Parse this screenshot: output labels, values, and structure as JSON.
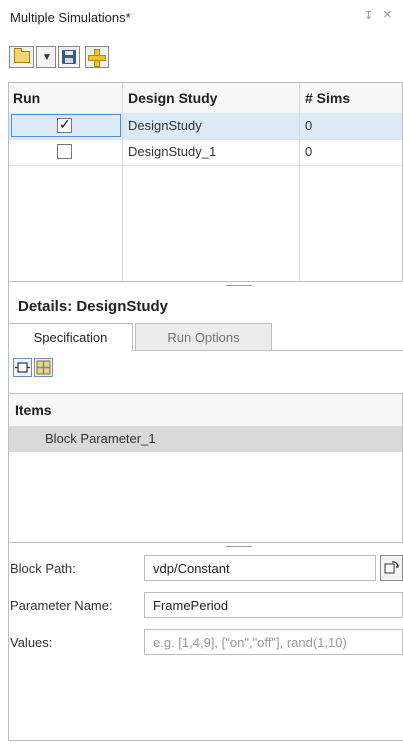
{
  "panel": {
    "title": "Multiple Simulations*",
    "pin_glyph": "↧",
    "close_glyph": "×"
  },
  "toolbar": {
    "buttons": [
      {
        "icon": "folder-icon"
      },
      {
        "icon": "chevron-down-icon"
      },
      {
        "icon": "save-icon"
      },
      {
        "icon": "add-icon"
      }
    ]
  },
  "studies_table": {
    "columns": [
      "Run",
      "Design Study",
      "# Sims"
    ],
    "rows": [
      {
        "checked": true,
        "name": "DesignStudy",
        "sims": "0",
        "selected": true
      },
      {
        "checked": false,
        "name": "DesignStudy_1",
        "sims": "0",
        "selected": false
      }
    ]
  },
  "details": {
    "title": "Details: DesignStudy",
    "tabs": [
      "Specification",
      "Run Options"
    ],
    "active_tab": "Specification",
    "items_header": "Items",
    "items": [
      "Block Parameter_1"
    ]
  },
  "form": {
    "block_path_label": "Block Path:",
    "block_path_value": "vdp/Constant",
    "parameter_name_label": "Parameter Name:",
    "parameter_name_value": "FramePeriod",
    "values_label": "Values:",
    "values_placeholder": "e.g. [1,4,9], [\"on\",\"off\"], rand(1,10)"
  },
  "colors": {
    "selection": "#dce9f7",
    "item_selected": "#d9d9d9",
    "accent": "#4d90d8"
  }
}
